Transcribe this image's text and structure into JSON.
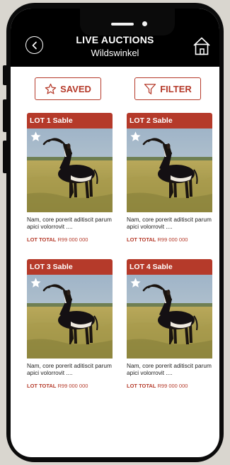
{
  "header": {
    "title": "LIVE AUCTIONS",
    "subtitle": "Wildswinkel"
  },
  "toolbar": {
    "saved_label": "SAVED",
    "filter_label": "FILTER"
  },
  "lots": [
    {
      "title": "LOT 1 Sable",
      "description": "Nam, core porerit aditiscit parum apici volorrovit ....",
      "total_label": "LOT TOTAL",
      "total_value": "R99 000 000"
    },
    {
      "title": "LOT 2 Sable",
      "description": "Nam, core porerit aditiscit parum apici volorrovit ....",
      "total_label": "LOT TOTAL",
      "total_value": "R99 000 000"
    },
    {
      "title": "LOT 3 Sable",
      "description": "Nam, core porerit aditiscit parum apici volorrovit ....",
      "total_label": "LOT TOTAL",
      "total_value": "R99 000 000"
    },
    {
      "title": "LOT 4 Sable",
      "description": "Nam, core porerit aditiscit parum apici volorrovit ....",
      "total_label": "LOT TOTAL",
      "total_value": "R99 000 000"
    }
  ],
  "icons": {
    "back": "chevron-left-icon",
    "home": "home-icon",
    "saved": "star-outline-icon",
    "filter": "funnel-icon",
    "favourite": "star-icon"
  },
  "colors": {
    "accent": "#b53a2a",
    "header_bg": "#000000",
    "background": "#ffffff"
  }
}
